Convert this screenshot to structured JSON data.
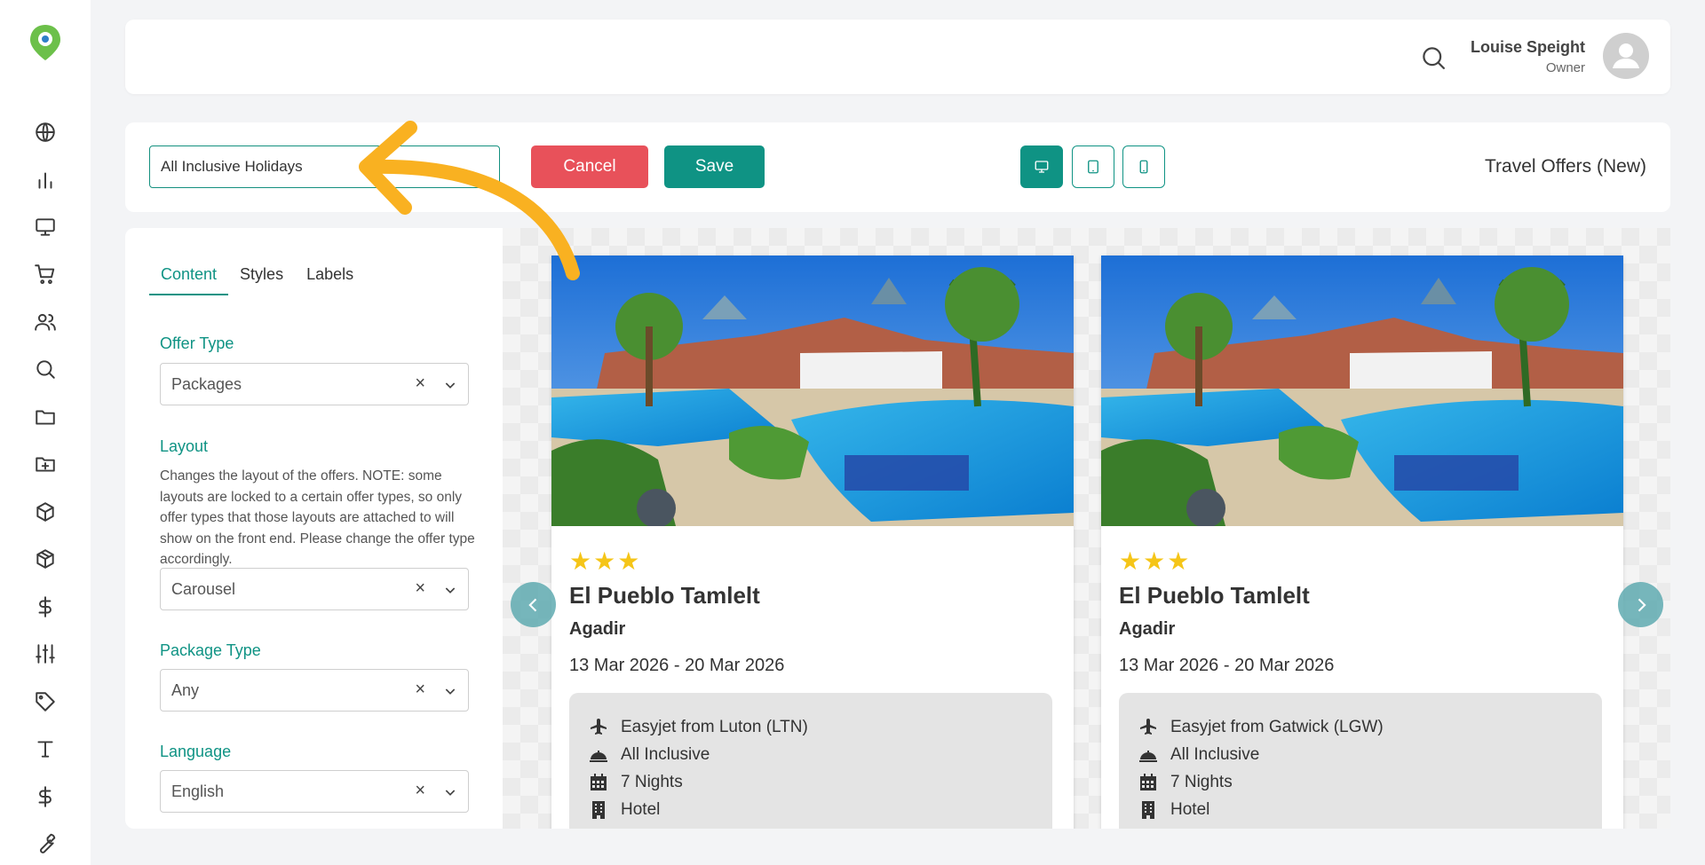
{
  "header": {
    "user_name": "Louise Speight",
    "user_role": "Owner"
  },
  "toolbar": {
    "title_value": "All Inclusive Holidays",
    "cancel_label": "Cancel",
    "save_label": "Save",
    "widget_title": "Travel Offers (New)"
  },
  "panel": {
    "tabs": [
      {
        "label": "Content",
        "active": true
      },
      {
        "label": "Styles",
        "active": false
      },
      {
        "label": "Labels",
        "active": false
      }
    ],
    "fields": {
      "offer_type": {
        "label": "Offer Type",
        "value": "Packages"
      },
      "layout": {
        "label": "Layout",
        "help": "Changes the layout of the offers. NOTE: some layouts are locked to a certain offer types, so only offer types that those layouts are attached to will show on the front end. Please change the offer type accordingly.",
        "value": "Carousel"
      },
      "package_type": {
        "label": "Package Type",
        "value": "Any"
      },
      "language": {
        "label": "Language",
        "value": "English"
      }
    },
    "clear_glyph": "×"
  },
  "cards": [
    {
      "stars": "★★★",
      "name": "El Pueblo Tamlelt",
      "city": "Agadir",
      "dates": "13 Mar 2026 - 20 Mar 2026",
      "features": [
        "Easyjet from Luton (LTN)",
        "All Inclusive",
        "7 Nights",
        "Hotel"
      ]
    },
    {
      "stars": "★★★",
      "name": "El Pueblo Tamlelt",
      "city": "Agadir",
      "dates": "13 Mar 2026 - 20 Mar 2026",
      "features": [
        "Easyjet from Gatwick (LGW)",
        "All Inclusive",
        "7 Nights",
        "Hotel"
      ]
    }
  ],
  "colors": {
    "accent": "#0f9384",
    "cancel": "#e8515a",
    "annotation": "#f9b121",
    "logo": "#6cc04a",
    "star": "#f5c518"
  },
  "icons": {
    "sidebar": [
      "globe-icon",
      "bar-chart-icon",
      "monitor-icon",
      "cart-icon",
      "users-icon",
      "search-icon",
      "folder-icon",
      "folder-plus-icon",
      "box-icon",
      "package-icon",
      "dollar-icon",
      "sliders-icon",
      "tag-icon",
      "type-icon",
      "dollar-icon",
      "wrench-icon"
    ],
    "features": [
      "plane-icon",
      "cloche-icon",
      "calendar-icon",
      "building-icon"
    ]
  }
}
